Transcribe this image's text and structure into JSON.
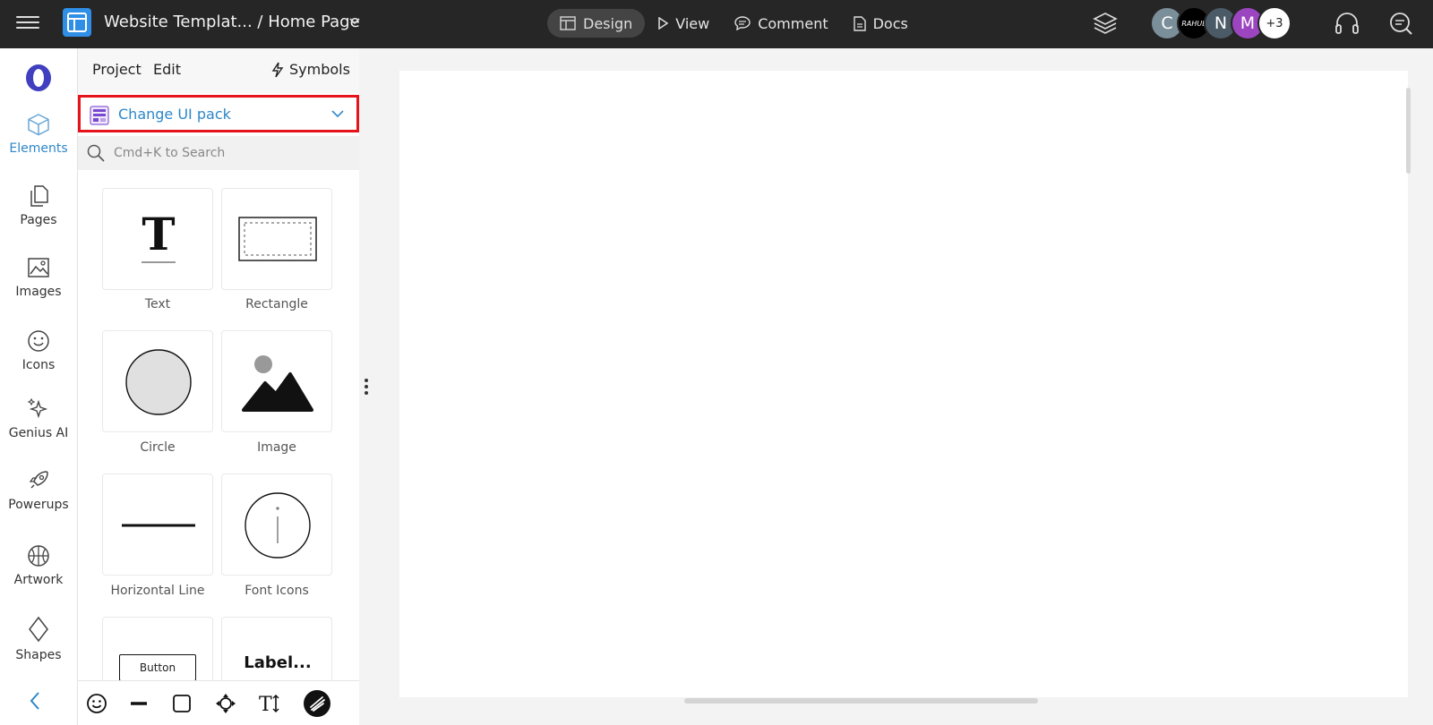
{
  "header": {
    "doc_title": "Website Templat... / Home Page",
    "nav": [
      {
        "label": "Design",
        "icon": "layout-icon",
        "active": true
      },
      {
        "label": "View",
        "icon": "play-icon"
      },
      {
        "label": "Comment",
        "icon": "comment-icon"
      },
      {
        "label": "Docs",
        "icon": "document-icon"
      }
    ],
    "avatars": [
      {
        "initial": "C",
        "color": "#7b8f9a"
      },
      {
        "initial": "RAHUL",
        "color": "#000000"
      },
      {
        "initial": "N",
        "color": "#4a5a66"
      },
      {
        "initial": "M",
        "color": "#9c45c0"
      },
      {
        "initial": "+3",
        "color": "#ffffff"
      }
    ]
  },
  "rail": {
    "items": [
      {
        "label": "Elements",
        "icon": "cube-icon",
        "active": true
      },
      {
        "label": "Pages",
        "icon": "pages-icon"
      },
      {
        "label": "Images",
        "icon": "image-icon"
      },
      {
        "label": "Icons",
        "icon": "smiley-icon"
      },
      {
        "label": "Genius AI",
        "icon": "sparkle-icon"
      },
      {
        "label": "Powerups",
        "icon": "rocket-icon"
      },
      {
        "label": "Artwork",
        "icon": "basketball-icon"
      },
      {
        "label": "Shapes",
        "icon": "diamond-icon"
      }
    ]
  },
  "panel": {
    "menu": {
      "project": "Project",
      "edit": "Edit",
      "symbols": "Symbols"
    },
    "ui_pack": {
      "label": "Change UI pack"
    },
    "search": {
      "placeholder": "Cmd+K to Search"
    },
    "tiles": [
      {
        "label": "Text"
      },
      {
        "label": "Rectangle"
      },
      {
        "label": "Circle"
      },
      {
        "label": "Image"
      },
      {
        "label": "Horizontal Line"
      },
      {
        "label": "Font Icons"
      },
      {
        "label": "",
        "preview_text": "Button"
      },
      {
        "label": "",
        "preview_text": "Label..."
      }
    ]
  },
  "colors": {
    "accent": "#2d87c8",
    "highlight": "#e5131a",
    "topbar": "#262626"
  }
}
